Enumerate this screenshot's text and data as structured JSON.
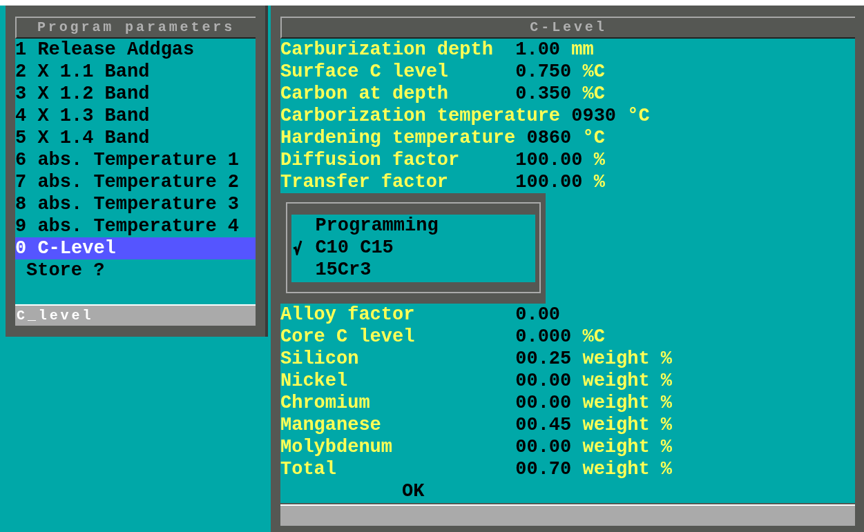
{
  "left_window": {
    "title": "Program parameters",
    "items": [
      {
        "label": "1 Release Addgas",
        "selected": false
      },
      {
        "label": "2 X 1.1 Band",
        "selected": false
      },
      {
        "label": "3 X 1.2 Band",
        "selected": false
      },
      {
        "label": "4 X 1.3 Band",
        "selected": false
      },
      {
        "label": "5 X 1.4 Band",
        "selected": false
      },
      {
        "label": "6 abs. Temperature 1",
        "selected": false
      },
      {
        "label": "7 abs. Temperature 2",
        "selected": false
      },
      {
        "label": "8 abs. Temperature 3",
        "selected": false
      },
      {
        "label": "9 abs. Temperature 4",
        "selected": false
      },
      {
        "label": "0 C-Level",
        "selected": true
      },
      {
        "label": "Store ?",
        "selected": false
      }
    ],
    "status_bar": "C_level"
  },
  "right_window": {
    "title": "C-Level",
    "parameters": [
      {
        "label": "Carburization depth",
        "value": "1.00",
        "unit": "mm"
      },
      {
        "label": "Surface C level",
        "value": "0.750",
        "unit": "%C"
      },
      {
        "label": "Carbon at depth",
        "value": "0.350",
        "unit": "%C"
      },
      {
        "label": "Carborization temperature",
        "value": "0930",
        "unit": "°C"
      },
      {
        "label": "Hardening temperature",
        "value": "0860",
        "unit": "°C"
      },
      {
        "label": "Diffusion factor",
        "value": "100.00",
        "unit": "%"
      },
      {
        "label": "Transfer factor",
        "value": "100.00",
        "unit": "%"
      }
    ],
    "programming": {
      "title": "Programming",
      "options": [
        {
          "label": "C10 C15",
          "checked": true
        },
        {
          "label": "15Cr3",
          "checked": false
        }
      ]
    },
    "alloy": [
      {
        "label": "Alloy factor",
        "value": "0.00"
      },
      {
        "label": "Core C level",
        "value": "0.000",
        "unit": "%C"
      },
      {
        "label": "Silicon",
        "value": "00.25",
        "unit": "weight %"
      },
      {
        "label": "Nickel",
        "value": "00.00",
        "unit": "weight %"
      },
      {
        "label": "Chromium",
        "value": "00.00",
        "unit": "weight %"
      },
      {
        "label": "Manganese",
        "value": "00.45",
        "unit": "weight %"
      },
      {
        "label": "Molybdenum",
        "value": "00.00",
        "unit": "weight %"
      },
      {
        "label": "Total",
        "value": "00.70",
        "unit": "weight %"
      }
    ],
    "ok_button": "OK"
  }
}
